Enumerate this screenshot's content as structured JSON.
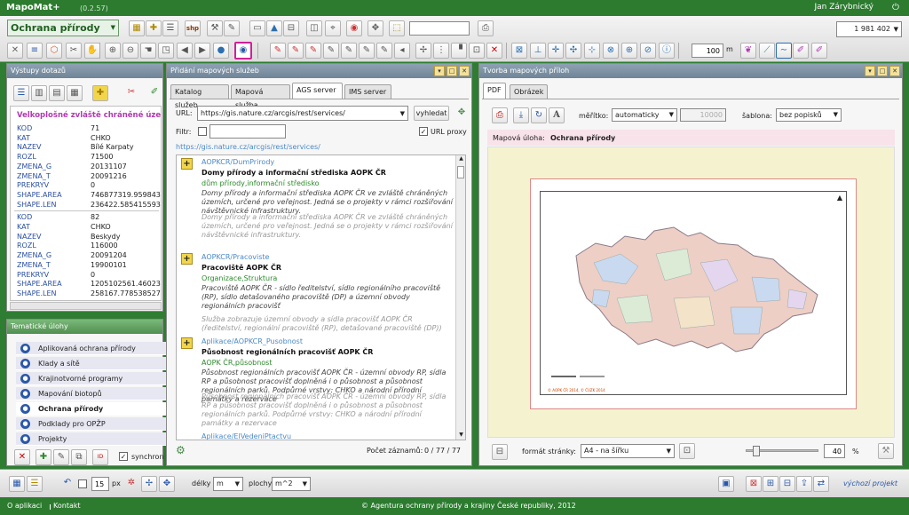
{
  "app": {
    "title": "MapoMat+",
    "version": "(0.2.57)",
    "user": "Jan Zárybnický"
  },
  "toolbar": {
    "task_select": "Ochrana přírody",
    "scale_value": "1 981 402",
    "zoom_input": "100",
    "zoom_unit": "m"
  },
  "outputs_panel": {
    "title": "Výstupy dotazů",
    "layer_title": "Velkoplošné zvláště chráněné území",
    "records": [
      [
        {
          "k": "KOD",
          "v": "71"
        },
        {
          "k": "KAT",
          "v": "CHKO"
        },
        {
          "k": "NAZEV",
          "v": "Bílé Karpaty"
        },
        {
          "k": "ROZL",
          "v": "71500"
        },
        {
          "k": "ZMENA_G",
          "v": "20131107"
        },
        {
          "k": "ZMENA_T",
          "v": "20091216"
        },
        {
          "k": "PREKRYV",
          "v": "0"
        },
        {
          "k": "SHAPE.AREA",
          "v": "746877319.959843"
        },
        {
          "k": "SHAPE.LEN",
          "v": "236422.585415593"
        }
      ],
      [
        {
          "k": "KOD",
          "v": "82"
        },
        {
          "k": "KAT",
          "v": "CHKO"
        },
        {
          "k": "NAZEV",
          "v": "Beskydy"
        },
        {
          "k": "ROZL",
          "v": "116000"
        },
        {
          "k": "ZMENA_G",
          "v": "20091204"
        },
        {
          "k": "ZMENA_T",
          "v": "19900101"
        },
        {
          "k": "PREKRYV",
          "v": "0"
        },
        {
          "k": "SHAPE.AREA",
          "v": "1205102561.46023"
        },
        {
          "k": "SHAPE.LEN",
          "v": "258167.778538527"
        }
      ]
    ]
  },
  "themes_panel": {
    "title": "Tematické úlohy",
    "items": [
      {
        "label": "Aplikovaná ochrana přírody",
        "active": false
      },
      {
        "label": "Klady a sítě",
        "active": false
      },
      {
        "label": "Krajinotvorné programy",
        "active": false
      },
      {
        "label": "Mapování biotopů",
        "active": false
      },
      {
        "label": "Ochrana přírody",
        "active": true
      },
      {
        "label": "Podklady pro OPŽP",
        "active": false
      },
      {
        "label": "Projekty",
        "active": false
      }
    ],
    "sync_label": "synchron"
  },
  "services_panel": {
    "title": "Přidání mapových služeb",
    "tabs": [
      "Katalog služeb",
      "Mapová služba",
      "AGS server",
      "IMS server"
    ],
    "active_tab": 2,
    "url_label": "URL:",
    "url_value": "https://gis.nature.cz/arcgis/rest/services/",
    "search_button": "vyhledat",
    "filter_label": "Filtr:",
    "proxy_label": "URL proxy",
    "base_url": "https://gis.nature.cz/arcgis/rest/services/",
    "items": [
      {
        "path": "AOPKCR/DumPrirody",
        "title": "Domy přírody a informační střediska AOPK ČR",
        "keywords": "dům přírody,informační středisko",
        "desc": "Domy přírody a informační střediska AOPK ČR ve zvláště chráněných územích, určené pro veřejnost. Jedná se o projekty v rámci rozšiřování návštěvnické infrastruktury.",
        "desc2": "Domy přírody a informační střediska AOPK ČR ve zvláště chráněných územích, určené pro veřejnost. Jedná se o projekty v rámci rozšiřování návštěvnické infrastruktury."
      },
      {
        "path": "AOPKCR/Pracoviste",
        "title": "Pracoviště AOPK ČR",
        "keywords": "Organizace,Struktura",
        "desc": "Pracoviště AOPK ČR - sídlo ředitelství, sídlo regionálního pracoviště (RP), sídlo detašovaného pracoviště (DP) a územní obvody regionálních pracovišť",
        "desc2": "Služba zobrazuje územní obvody a sídla pracovišť AOPK ČR (ředitelství, regionální pracoviště (RP), detašované pracoviště (DP))"
      },
      {
        "path": "Aplikace/AOPKCR_Pusobnost",
        "title": "Působnost regionálních pracovišť AOPK ČR",
        "keywords": "AOPK ČR,působnost",
        "desc": "Působnost regionálních pracovišť AOPK ČR - územní obvody RP, sídla RP a působnost pracovišť doplněná i o působnost a působnost regionálních parků. Podpůrné vrstvy: CHKO a národní přírodní památky a rezervace",
        "desc2": "Působnost regionálních pracovišť AOPK ČR - územní obvody RP, sídla RP a působnost pracovišť doplněná i o působnost a působnost regionálních parků. Podpůrné vrstvy: CHKO a národní přírodní památky a rezervace"
      }
    ],
    "next_path": "Aplikace/EIVedeniPtactvu",
    "count_label": "Počet záznamů:",
    "count_value": "0 / 77 / 77"
  },
  "print_panel": {
    "title": "Tvorba mapových příloh",
    "tabs": [
      "PDF",
      "Obrázek"
    ],
    "scale_label": "měřítko:",
    "scale_select": "automaticky",
    "scale_input": "10000",
    "template_label": "šablona:",
    "template_select": "bez popisků",
    "map_task_label": "Mapová úloha:",
    "map_task_value": "Ochrana přírody",
    "map_footer": "© AOPK ČR 2014, © ČÚZK 2014",
    "format_label": "formát stránky:",
    "format_select": "A4 - na šířku",
    "slider_level": 0.1,
    "zoom_value": "40",
    "zoom_unit": "%"
  },
  "bottom": {
    "width_value": "15",
    "width_unit": "px",
    "length_label": "délky",
    "length_unit": "m",
    "area_label": "plochy",
    "area_unit": "m^2",
    "default_project": "výchozí projekt"
  },
  "footer": {
    "about": "O aplikaci",
    "contact": "Kontakt",
    "copyright": "© Agentura ochrany přírody a krajiny České republiky, 2012"
  }
}
